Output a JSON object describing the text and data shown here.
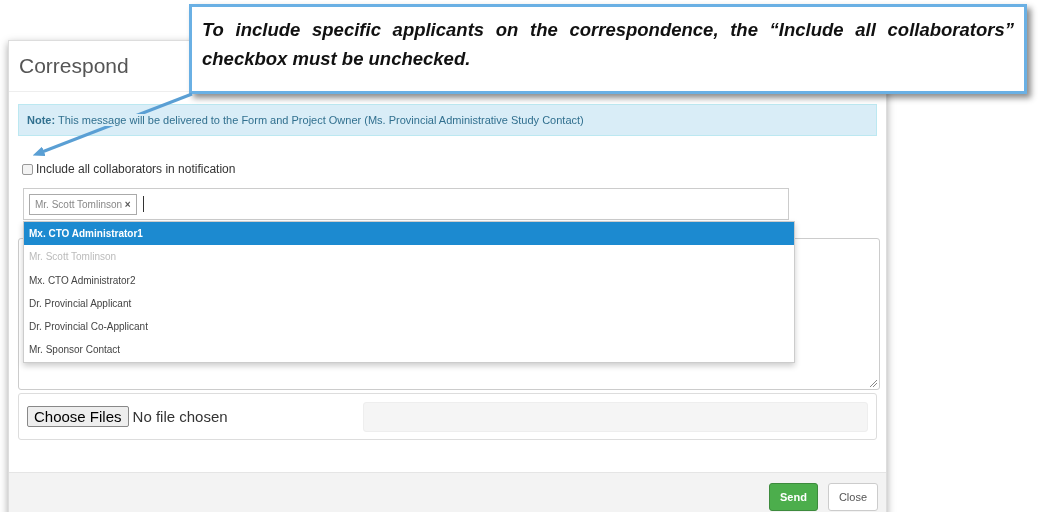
{
  "callout": {
    "text": "To include specific applicants on the correspondence, the “Include all collaborators” checkbox must be unchecked."
  },
  "dialog": {
    "title": "Correspond",
    "note": {
      "label": "Note:",
      "text": "This message will be delivered to the Form and Project Owner (Ms. Provincial Administrative Study Contact)"
    },
    "include_all": {
      "label": "Include all collaborators in notification",
      "checked": false
    },
    "recipients": {
      "tags": [
        {
          "label": "Mr. Scott Tomlinson",
          "remove": "×"
        }
      ]
    },
    "dropdown": [
      {
        "label": "Mx. CTO Administrator1",
        "selected": true,
        "disabled": false
      },
      {
        "label": "Mr. Scott Tomlinson",
        "selected": false,
        "disabled": true
      },
      {
        "label": "Mx. CTO Administrator2",
        "selected": false,
        "disabled": false
      },
      {
        "label": "Dr. Provincial Applicant",
        "selected": false,
        "disabled": false
      },
      {
        "label": "Dr. Provincial Co-Applicant",
        "selected": false,
        "disabled": false
      },
      {
        "label": "Mr. Sponsor Contact",
        "selected": false,
        "disabled": false
      }
    ],
    "file": {
      "button": "Choose Files",
      "status": "No file chosen",
      "upload": {
        "level": 0
      }
    },
    "buttons": [
      {
        "label": "Send",
        "kind": "primary"
      },
      {
        "label": "Close",
        "kind": "default"
      }
    ]
  }
}
